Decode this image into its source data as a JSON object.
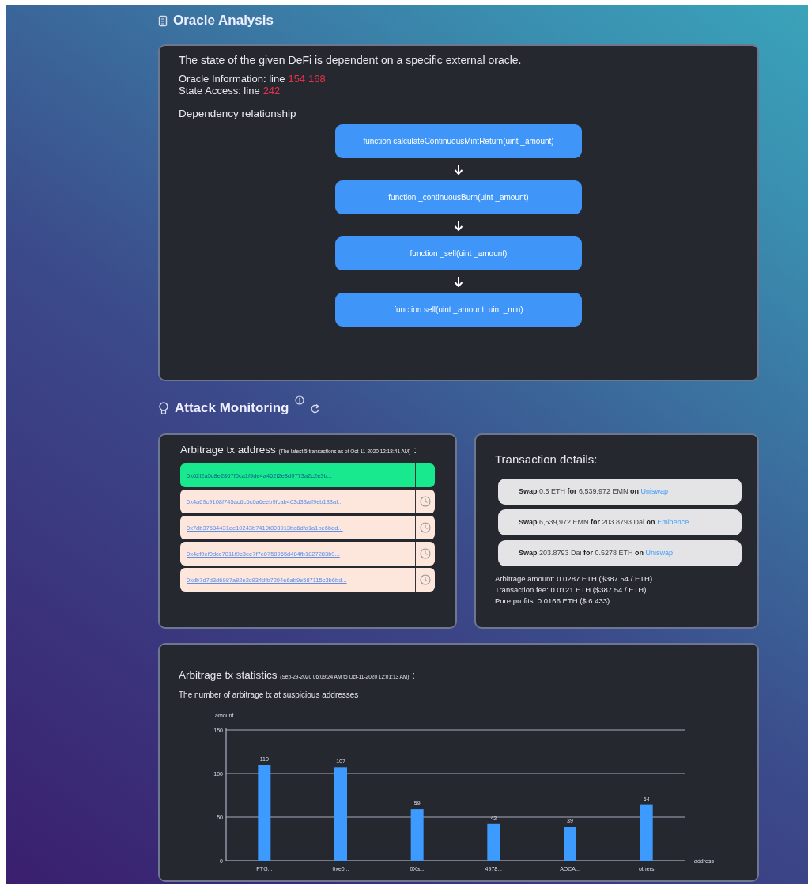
{
  "oracle": {
    "title": "Oracle Analysis",
    "summary": "The state of the given DeFi is dependent on a specific external oracle.",
    "info_label": "Oracle Information: line",
    "info_lines": [
      "154",
      "168"
    ],
    "access_label": "State Access: line",
    "access_lines": [
      "242"
    ],
    "dependency_title": "Dependency relationship",
    "functions": [
      "function calculateContinuousMintReturn(uint _amount)",
      "function _continuousBurn(uint _amount)",
      "function _sell(uint _amount)",
      "function sell(uint _amount, uint _min)"
    ]
  },
  "monitoring": {
    "title": "Attack Monitoring",
    "address_card": {
      "title": "Arbitrage tx address",
      "note": "(The latest 5 transactions as of Oct-11-2020 12:18:41 AM)",
      "colon": ":",
      "rows": [
        {
          "address": "0x62f2a5c8e2867f0ca1f9de4a462f2e8d9773a2c2e3b...",
          "selected": true
        },
        {
          "address": "0x4a09c9108f745ac6c6c0a6eeb9fcab403d33aff9eb183af...",
          "selected": false
        },
        {
          "address": "0x7db37584431ee10243b7410f803913ba6dfa1a1be6bed...",
          "selected": false
        },
        {
          "address": "0x4ef0ef0dcc7011f9c3ee7f7e0758965d484fb1827283b9...",
          "selected": false
        },
        {
          "address": "0xdb7d7d3d6987a92e2c934dfb7294e6ab9e587115c3b6bd...",
          "selected": false
        }
      ]
    },
    "details_card": {
      "title": "Transaction details:",
      "swaps": [
        {
          "verb": "Swap",
          "amount_in": "0.5 ETH",
          "for": "for",
          "amount_out": "6,539,972 EMN",
          "on": "on",
          "venue": "Uniswap"
        },
        {
          "verb": "Swap",
          "amount_in": "6,539,972 EMN",
          "for": "for",
          "amount_out": "203.8793 Dai",
          "on": "on",
          "venue": "Eminence"
        },
        {
          "verb": "Swap",
          "amount_in": "203.8793 Dai",
          "for": "for",
          "amount_out": "0.5278 ETH",
          "on": "on",
          "venue": "Uniswap"
        }
      ],
      "summary": [
        "Arbitrage amount: 0.0287 ETH ($387.54 / ETH)",
        "Transaction fee: 0.0121 ETH ($387.54 / ETH)",
        "Pure profits: 0.0166 ETH ($ 6.433)"
      ]
    },
    "stats_card": {
      "title": "Arbitrage tx statistics",
      "note": "(Sep-29-2020 06:09:24 AM to Oct-11-2020 12:01:13 AM)",
      "colon": ":",
      "subtitle": "The number of arbitrage tx at suspicious addresses",
      "chart_data": {
        "type": "bar",
        "xlabel": "address",
        "ylabel": "amount",
        "categories": [
          "PTG...",
          "0xe0...",
          "0Xa...",
          "4978...",
          "AOCA...",
          "others"
        ],
        "values": [
          110,
          107,
          59,
          42,
          39,
          64
        ],
        "ylim": [
          0,
          150
        ],
        "yticks": [
          0,
          50,
          100,
          150
        ],
        "data_labels": true
      }
    }
  }
}
